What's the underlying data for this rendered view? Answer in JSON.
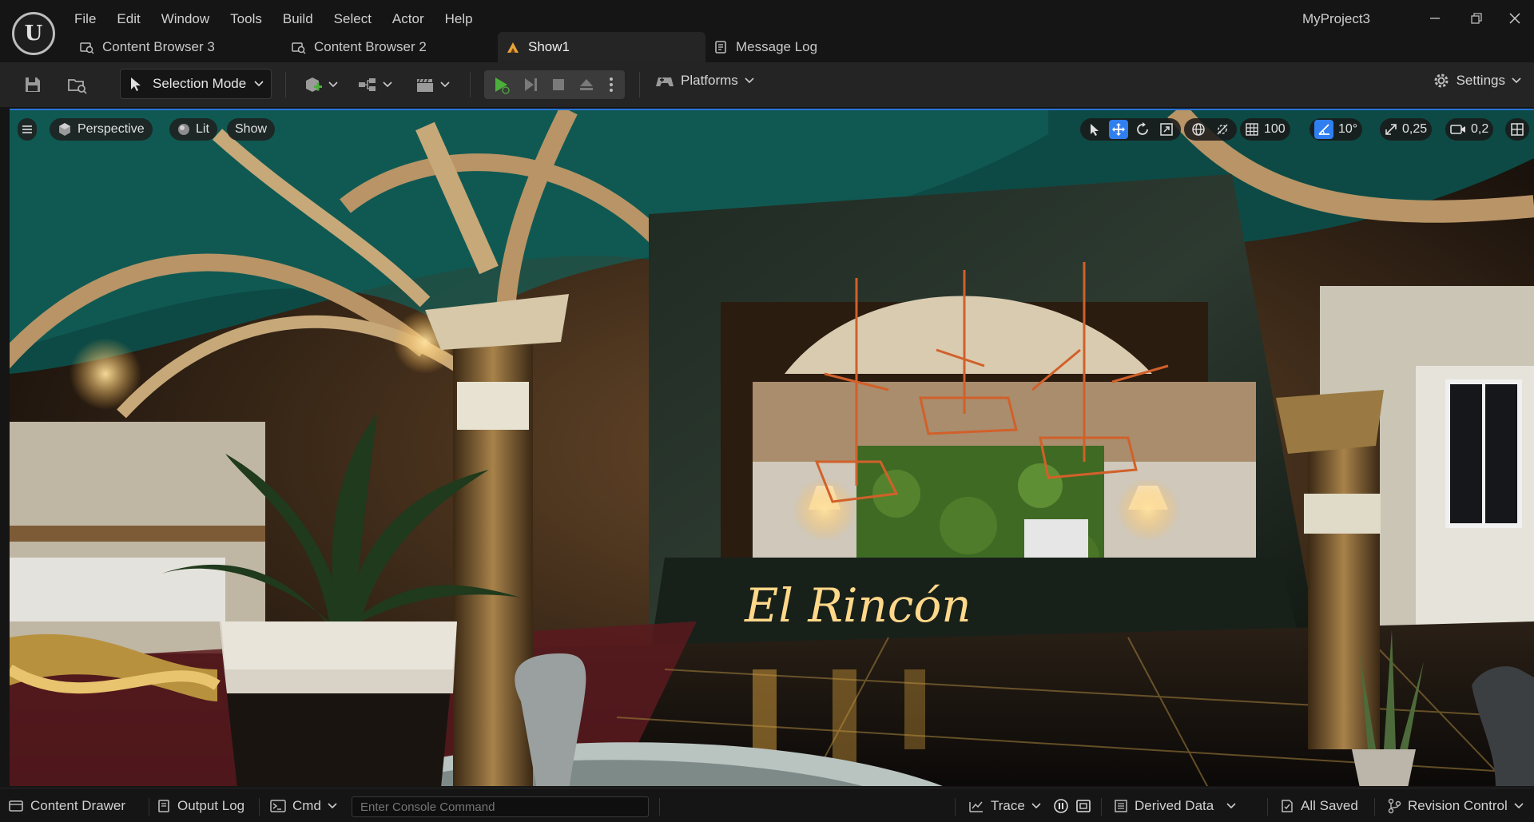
{
  "app": {
    "project_name": "MyProject3",
    "logo_letter": "U"
  },
  "menu": [
    "File",
    "Edit",
    "Window",
    "Tools",
    "Build",
    "Select",
    "Actor",
    "Help"
  ],
  "tabs": [
    {
      "label": "Content Browser 3",
      "icon": "content-browser-icon"
    },
    {
      "label": "Content Browser 2",
      "icon": "content-browser-icon"
    },
    {
      "label": "Show1",
      "icon": "level-icon",
      "active": true
    },
    {
      "label": "Message Log",
      "icon": "message-log-icon"
    }
  ],
  "toolbar": {
    "selection_mode": "Selection Mode",
    "platforms": "Platforms",
    "settings": "Settings"
  },
  "viewport": {
    "menu_icon": "hamburger-icon",
    "view_mode": "Perspective",
    "lighting": "Lit",
    "show": "Show",
    "grid_snap": "100",
    "rotation_snap": "10°",
    "scale_snap": "0,25",
    "camera_speed": "0,2",
    "sign_text": "El Rincón"
  },
  "statusbar": {
    "content_drawer": "Content Drawer",
    "output_log": "Output Log",
    "cmd": "Cmd",
    "console_placeholder": "Enter Console Command",
    "trace": "Trace",
    "derived_data": "Derived Data",
    "all_saved": "All Saved",
    "revision_control": "Revision Control"
  },
  "colors": {
    "accent": "#2f7ff0",
    "play_green": "#4caf3c",
    "bg": "#151515",
    "toolbar": "#242424"
  }
}
